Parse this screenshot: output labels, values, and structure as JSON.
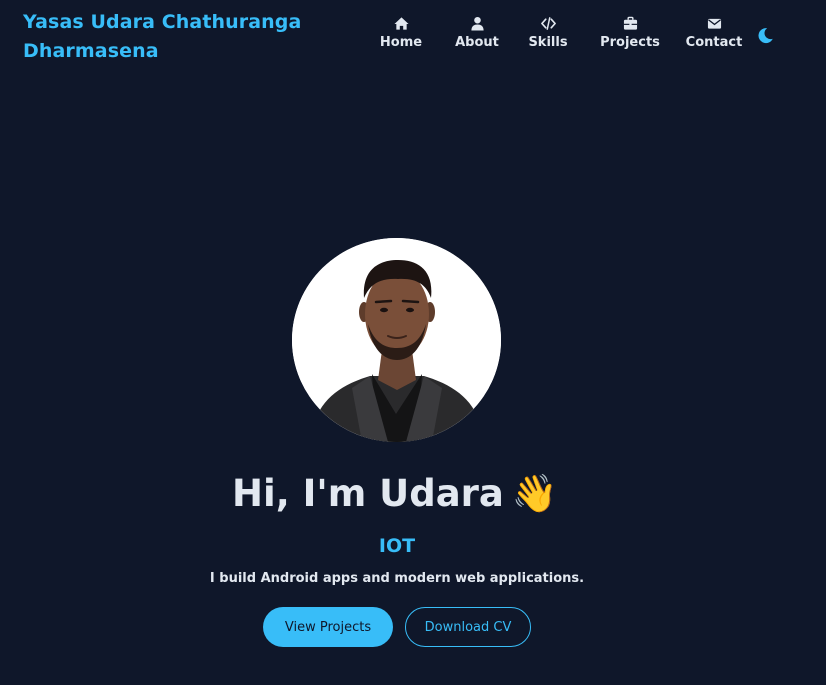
{
  "header": {
    "brand": "Yasas Udara Chathuranga Dharmasena",
    "nav": [
      {
        "label": "Home",
        "icon": "home-icon"
      },
      {
        "label": "About",
        "icon": "user-icon"
      },
      {
        "label": "Skills",
        "icon": "code-icon"
      },
      {
        "label": "Projects",
        "icon": "briefcase-icon"
      },
      {
        "label": "Contact",
        "icon": "envelope-icon"
      }
    ],
    "theme_toggle_icon": "moon-icon"
  },
  "hero": {
    "greeting": "Hi, I'm Udara",
    "wave": "👋",
    "role": "IOT",
    "tagline": "I build Android apps and modern web applications.",
    "primary_button": "View Projects",
    "secondary_button": "Download CV"
  },
  "colors": {
    "background": "#0f172a",
    "accent": "#38bdf8",
    "text": "#e2e8f0"
  }
}
